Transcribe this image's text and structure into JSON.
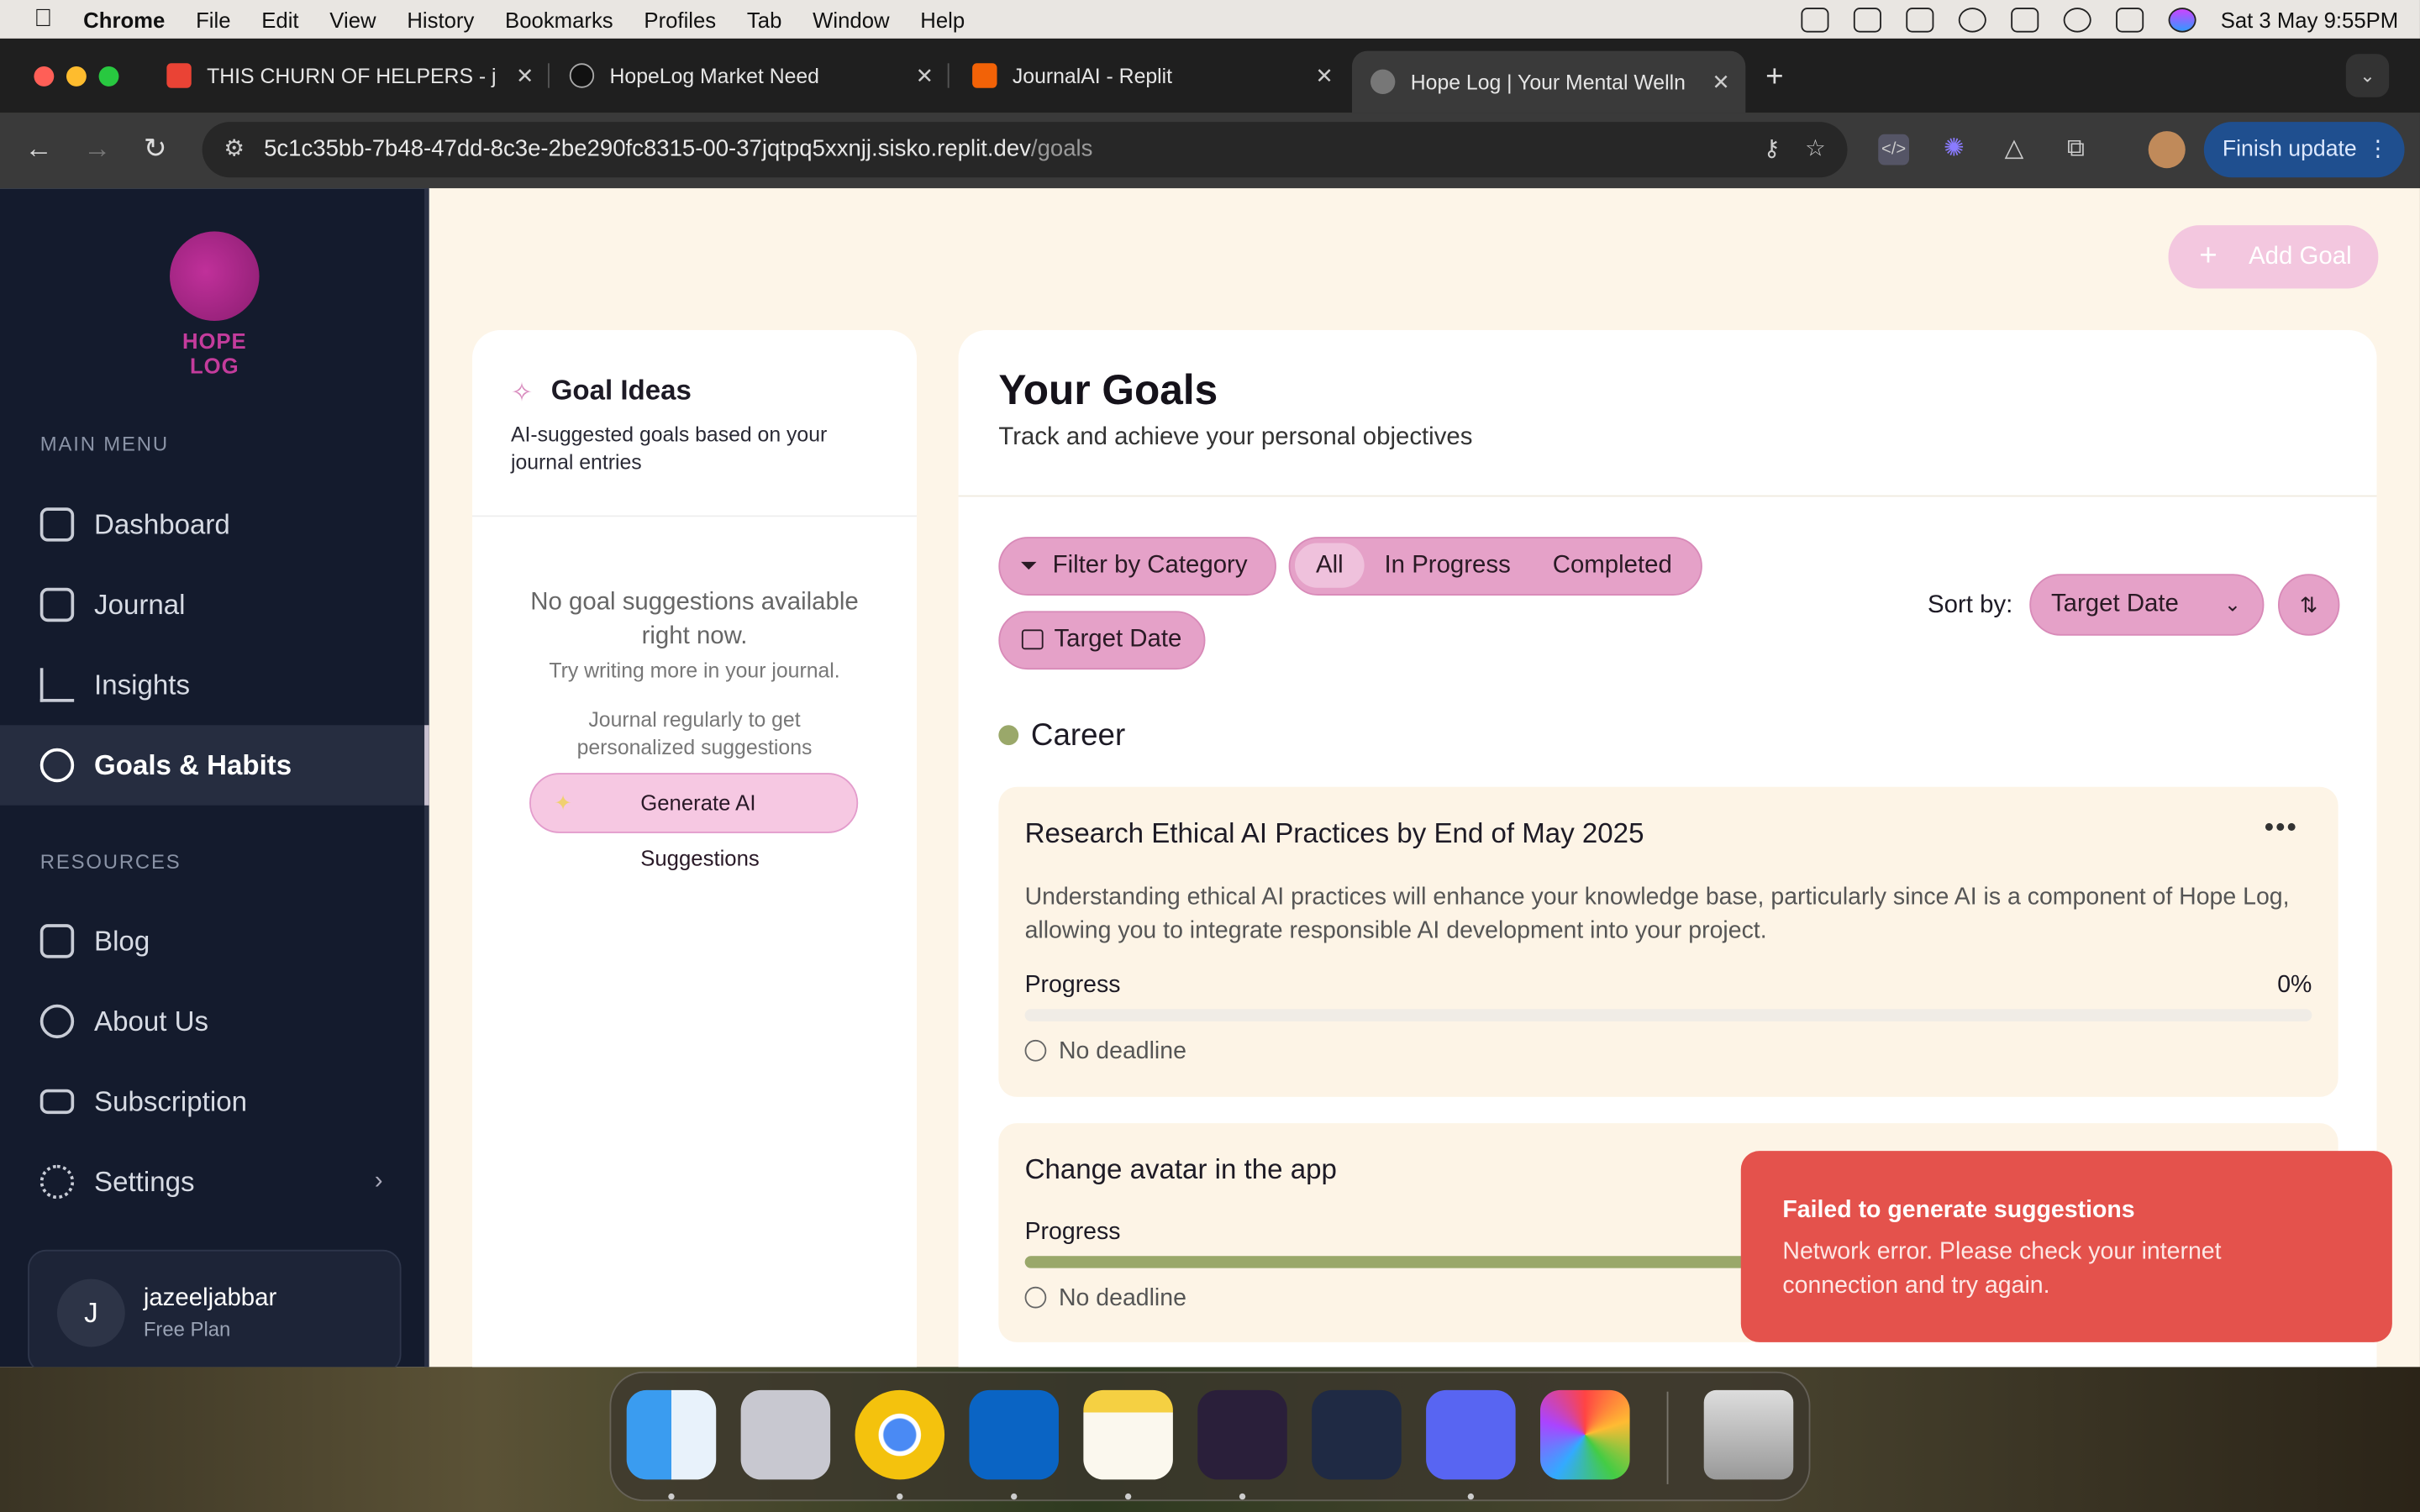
{
  "menubar": {
    "app": "Chrome",
    "items": [
      "File",
      "Edit",
      "View",
      "History",
      "Bookmarks",
      "Profiles",
      "Tab",
      "Window",
      "Help"
    ],
    "datetime": "Sat 3 May  9:55PM"
  },
  "tabs": [
    {
      "title": "THIS CHURN OF HELPERS - j",
      "fav": "#ea4335"
    },
    {
      "title": "HopeLog Market Need",
      "fav": "#000000"
    },
    {
      "title": "JournalAI - Replit",
      "fav": "#f26207"
    },
    {
      "title": "Hope Log | Your Mental Welln",
      "fav": "#888888"
    }
  ],
  "omnibox": {
    "host": "5c1c35bb-7b48-47dd-8c3e-2be290fc8315-00-37jqtpq5xxnjj.sisko.replit.dev",
    "path": "/goals"
  },
  "finish_update": "Finish update",
  "sidebar": {
    "logo_text": "HOPE LOG",
    "main_menu_label": "MAIN MENU",
    "main_items": [
      {
        "label": "Dashboard"
      },
      {
        "label": "Journal"
      },
      {
        "label": "Insights"
      },
      {
        "label": "Goals & Habits"
      }
    ],
    "resources_label": "RESOURCES",
    "resource_items": [
      {
        "label": "Blog"
      },
      {
        "label": "About Us"
      },
      {
        "label": "Subscription"
      },
      {
        "label": "Settings"
      }
    ],
    "user": {
      "initial": "J",
      "name": "jazeeljabbar",
      "plan": "Free Plan"
    }
  },
  "add_goal": "Add Goal",
  "ideas": {
    "title": "Goal Ideas",
    "subtitle": "AI-suggested goals based on your journal entries",
    "empty_title": "No goal suggestions available right now.",
    "empty_hint": "Try writing more in your journal.",
    "tip": "Journal regularly to get personalized suggestions",
    "button": "Generate AI Suggestions"
  },
  "goals": {
    "title": "Your Goals",
    "subtitle": "Track and achieve your personal objectives",
    "filter_label": "Filter by Category",
    "segments": [
      "All",
      "In Progress",
      "Completed"
    ],
    "target_date_chip": "Target Date",
    "sort_label": "Sort by:",
    "sort_value": "Target Date",
    "category": "Career",
    "items": [
      {
        "title": "Research Ethical AI Practices by End of May 2025",
        "description": "Understanding ethical AI practices will enhance your knowledge base, particularly since AI is a component of Hope Log, allowing you to integrate responsible AI development into your project.",
        "progress_label": "Progress",
        "progress_text": "0%",
        "progress": 0,
        "deadline": "No deadline"
      },
      {
        "title": "Change avatar in the app",
        "progress_label": "Progress",
        "progress": 0.6,
        "deadline": "No deadline"
      }
    ]
  },
  "toast": {
    "title": "Failed to generate suggestions",
    "message": "Network error. Please check your internet connection and try again."
  },
  "colors": {
    "accent_pink": "#e5a1c8",
    "sidebar_bg": "#141b2d",
    "progress": "#9aa86a",
    "toast": "#e4524c"
  }
}
